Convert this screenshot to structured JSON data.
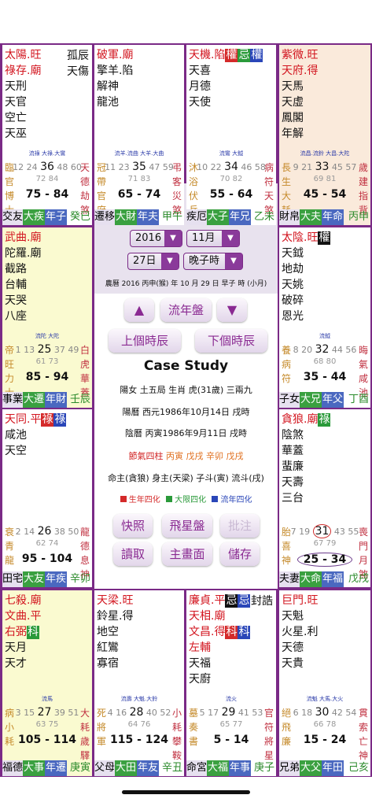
{
  "palaces": {
    "si": {
      "lines": [
        [
          [
            "太陽.旺",
            "red"
          ]
        ],
        [
          [
            "祿存.廟",
            "red"
          ]
        ],
        [
          [
            "天刑",
            ""
          ]
        ],
        [
          [
            "天官",
            ""
          ]
        ],
        [
          [
            "空亡",
            ""
          ]
        ],
        [
          [
            "天巫",
            ""
          ]
        ]
      ],
      "right": [
        "孤辰",
        "天傷"
      ],
      "flow": "流祿 大祿.大鸞",
      "row1": [
        "12",
        "24",
        "36",
        "48",
        "60"
      ],
      "row2": "72 84",
      "sl": "臨官博士",
      "sr": "天德劫煞",
      "range": "75 - 84",
      "bottom": [
        "交友",
        "大疾",
        "年子"
      ],
      "stem": "癸巳"
    },
    "wu": {
      "lines": [
        [
          [
            "破軍.廟",
            "red"
          ]
        ],
        [
          [
            "擎羊.陷",
            ""
          ]
        ],
        [
          [
            "解神",
            ""
          ]
        ],
        [
          [
            "龍池",
            ""
          ]
        ]
      ],
      "right": [],
      "flow": "流羊.流曲 大羊.大曲",
      "row1": [
        "11",
        "23",
        "35",
        "47",
        "59"
      ],
      "row2": "71 83",
      "sl": "冠帶官府",
      "sr": "弔客災煞",
      "range": "65 - 74",
      "bottom": [
        "遷移",
        "大財",
        "年夫"
      ],
      "stem": "甲午"
    },
    "wei": {
      "lines": [
        [
          [
            "天機.陷",
            "red"
          ],
          [
            "權",
            "r"
          ],
          [
            "忌",
            "g"
          ],
          [
            "權",
            "b"
          ]
        ],
        [
          [
            "天喜",
            ""
          ]
        ],
        [
          [
            "月德",
            ""
          ]
        ],
        [
          [
            "天使",
            ""
          ]
        ]
      ],
      "right": [],
      "flow": "流鸞 大鉞",
      "row1": [
        "10",
        "22",
        "34",
        "46",
        "58"
      ],
      "row2": "70 82",
      "sl": "沐浴伏兵",
      "sr": "病符天煞",
      "range": "55 - 64",
      "bottom": [
        "疾厄",
        "大子",
        "年兄"
      ],
      "stem": "乙未"
    },
    "shen": {
      "lines": [
        [
          [
            "紫微.旺",
            "red"
          ]
        ],
        [
          [
            "天府.得",
            "red"
          ]
        ],
        [
          [
            "天馬",
            ""
          ]
        ],
        [
          [
            "天虛",
            ""
          ]
        ],
        [
          [
            "鳳閣",
            ""
          ]
        ],
        [
          [
            "年解",
            ""
          ]
        ]
      ],
      "right": [],
      "flow": "流昌.流鈴 大昌.大陀",
      "row1": [
        "9",
        "21",
        "33",
        "45",
        "57"
      ],
      "row2": "69 81",
      "sl": "長生大耗",
      "sr": "歲建指背",
      "range": "45 - 54",
      "bottom": [
        "財帛",
        "大夫",
        "年命"
      ],
      "stem": "丙申"
    },
    "chen": {
      "lines": [
        [
          [
            "武曲.廟",
            "red"
          ]
        ],
        [
          [
            "陀羅.廟",
            ""
          ]
        ],
        [
          [
            "截路",
            ""
          ]
        ],
        [
          [
            "台輔",
            ""
          ]
        ],
        [
          [
            "天哭",
            ""
          ]
        ],
        [
          [
            "八座",
            ""
          ]
        ]
      ],
      "right": [],
      "flow": "流陀 大陀",
      "row1": [
        "1",
        "13",
        "25",
        "37",
        "49"
      ],
      "row2": "61 73",
      "sl": "帝旺力士",
      "sr": "白虎華蓋",
      "range": "85 - 94",
      "bottom": [
        "事業",
        "大遷",
        "年財"
      ],
      "stem": "壬辰"
    },
    "you": {
      "lines": [
        [
          [
            "太陰.旺",
            "red"
          ],
          [
            "權",
            "k"
          ]
        ],
        [
          [
            "天鉞",
            ""
          ]
        ],
        [
          [
            "地劫",
            ""
          ]
        ],
        [
          [
            "天姚",
            ""
          ]
        ],
        [
          [
            "破碎",
            ""
          ]
        ],
        [
          [
            "恩光",
            ""
          ]
        ]
      ],
      "right": [],
      "flow": "流鉞",
      "row1": [
        "8",
        "20",
        "32",
        "44",
        "56"
      ],
      "row2": "68 80",
      "sl": "養病符",
      "sr": "晦氣咸池",
      "range": "35 - 44",
      "bottom": [
        "子女",
        "大兄",
        "年父"
      ],
      "stem": "丁酉"
    },
    "mao": {
      "lines": [
        [
          [
            "天同.平",
            "red"
          ],
          [
            "祿",
            "r"
          ],
          [
            "祿",
            "b"
          ]
        ],
        [
          [
            "咸池",
            ""
          ]
        ],
        [
          [
            "天空",
            ""
          ]
        ]
      ],
      "right": [],
      "flow": "",
      "row1": [
        "2",
        "14",
        "26",
        "38",
        "50"
      ],
      "row2": "62 74",
      "sl": "衰青龍",
      "sr": "龍德息神",
      "range": "95 - 104",
      "bottom": [
        "田宅",
        "大友",
        "年疾"
      ],
      "stem": "辛卯"
    },
    "xu": {
      "lines": [
        [
          [
            "貪狼.廟",
            "red"
          ],
          [
            "祿",
            "g"
          ]
        ],
        [
          [
            "陰煞",
            ""
          ]
        ],
        [
          [
            "華蓋",
            ""
          ]
        ],
        [
          [
            "蜚廉",
            ""
          ]
        ],
        [
          [
            "天壽",
            ""
          ]
        ],
        [
          [
            "三台",
            ""
          ]
        ]
      ],
      "right": [],
      "flow": "",
      "row1": [
        "7",
        "19",
        "31",
        "43",
        "55"
      ],
      "row2": "67 79",
      "sl": "胎喜神",
      "sr": "喪門月煞",
      "range": "25 - 34",
      "bottom": [
        "夫妻",
        "大命",
        "年福"
      ],
      "stem": "戊戌"
    },
    "yin": {
      "lines": [
        [
          [
            "七殺.廟",
            "red"
          ]
        ],
        [
          [
            "文曲.平",
            "red"
          ]
        ],
        [
          [
            "右弼",
            "red"
          ],
          [
            "科",
            "g"
          ]
        ],
        [
          [
            "天月",
            ""
          ]
        ],
        [
          [
            "天才",
            ""
          ]
        ]
      ],
      "right": [],
      "flow": "流馬",
      "row1": [
        "3",
        "15",
        "27",
        "39",
        "51"
      ],
      "row2": "63 75",
      "sl": "病小耗",
      "sr": "大耗歲驛",
      "range": "105 - 114",
      "bottom": [
        "福德",
        "大事",
        "年遷"
      ],
      "stem": "庚寅"
    },
    "chou": {
      "lines": [
        [
          [
            "天梁.旺",
            "red"
          ]
        ],
        [
          [
            "鈴星.得",
            ""
          ]
        ],
        [
          [
            "地空",
            ""
          ]
        ],
        [
          [
            "紅鸞",
            ""
          ]
        ],
        [
          [
            "寡宿",
            ""
          ]
        ]
      ],
      "right": [],
      "flow": "流壽 大魁.大鈴",
      "row1": [
        "4",
        "16",
        "28",
        "40",
        "52"
      ],
      "row2": "64 76",
      "sl": "死將軍",
      "sr": "小耗攀鞍",
      "range": "115 - 124",
      "bottom": [
        "父母",
        "大田",
        "年友"
      ],
      "stem": "辛丑"
    },
    "zi": {
      "lines": [
        [
          [
            "廉貞.平",
            "red"
          ],
          [
            "忌",
            "k"
          ],
          [
            "忌",
            "b"
          ]
        ],
        [
          [
            "天相.廟",
            "red"
          ]
        ],
        [
          [
            "文昌.得",
            "red"
          ],
          [
            "科",
            "r"
          ],
          [
            "科",
            "b"
          ]
        ],
        [
          [
            "左輔",
            "red"
          ]
        ],
        [
          [
            "天福",
            ""
          ]
        ],
        [
          [
            "天廚",
            ""
          ]
        ]
      ],
      "right": [
        "封誥"
      ],
      "flow": "流火",
      "row1": [
        "5",
        "17",
        "29",
        "41",
        "53"
      ],
      "row2": "65 77",
      "sl": "墓奏書",
      "sr": "官符將星",
      "range": "5 - 14",
      "bottom": [
        "命宮",
        "大福",
        "年事"
      ],
      "stem": "庚子"
    },
    "hai": {
      "lines": [
        [
          [
            "巨門.旺",
            "red"
          ]
        ],
        [
          [
            "天魁",
            ""
          ]
        ],
        [
          [
            "火星.利",
            ""
          ]
        ],
        [
          [
            "天德",
            ""
          ]
        ],
        [
          [
            "天貴",
            ""
          ]
        ]
      ],
      "right": [],
      "flow": "流魁 大馬.大火",
      "row1": [
        "6",
        "18",
        "30",
        "42",
        "54"
      ],
      "row2": "66 78",
      "sl": "絕飛廉",
      "sr": "貫索亡神",
      "range": "15 - 24",
      "bottom": [
        "兄弟",
        "大父",
        "年田"
      ],
      "stem": "己亥"
    }
  },
  "center": {
    "year": "2016",
    "month": "11月",
    "day": "27日",
    "hour": "晚子時",
    "lunar": "農曆 2016 丙申(猴) 年 10 月 29 日 早子 時 (小月)",
    "prev_btn": "▲",
    "flow_btn": "流年盤",
    "next_btn": "▼",
    "prev_hour": "上個時辰",
    "next_hour": "下個時辰",
    "title": "Case Study",
    "info1": "陽女 土五局 生肖 虎(31歲) 三兩九",
    "info2": "陽曆 西元1986年10月14日 戌時",
    "info3": "陰曆 丙寅1986年9月11日 戌時",
    "jieqi_label": "節氣四柱",
    "jieqi_values": "丙寅 戊戌 辛卯 戊戌",
    "masters": "命主(貪狼) 身主(天梁) 子斗(寅) 流斗(戌)",
    "legend": [
      "生年四化",
      "大限四化",
      "流年四化"
    ],
    "legend_colors": [
      "#d42a2a",
      "#2a9a3a",
      "#2a46b8"
    ],
    "b1": "快照",
    "b2": "飛星盤",
    "b3": "批注",
    "b4": "讀取",
    "b5": "主畫面",
    "b6": "儲存"
  }
}
